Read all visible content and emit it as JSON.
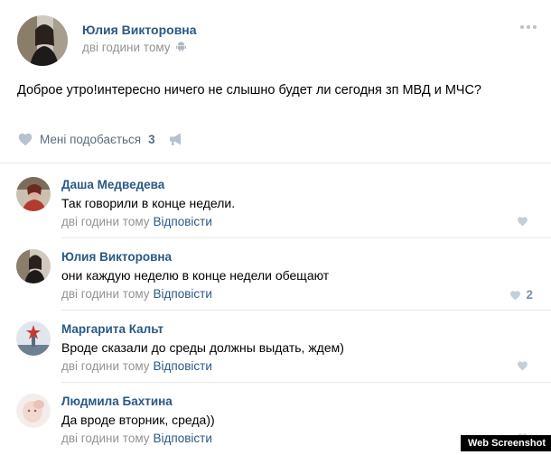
{
  "post": {
    "author": "Юлия Викторовна",
    "time": "дві години тому",
    "text": "Доброе утро!интересно ничего не слышно будет ли сегодня зп МВД и МЧС?",
    "like_label": "Мені подобається",
    "like_count": "3"
  },
  "comments": [
    {
      "author": "Даша Медведева",
      "text": "Так говорили в конце недели.",
      "time": "дві години тому",
      "reply": "Відповісти",
      "likes": ""
    },
    {
      "author": "Юлия Викторовна",
      "text": "они каждую неделю в конце недели обещают",
      "time": "дві години тому",
      "reply": "Відповісти",
      "likes": "2"
    },
    {
      "author": "Маргарита Кальт",
      "text": "Вроде сказали до среды должны выдать, ждем)",
      "time": "дві години тому",
      "reply": "Відповісти",
      "likes": ""
    },
    {
      "author": "Людмила Бахтина",
      "text": "Да вроде вторник, среда))",
      "time": "дві години тому",
      "reply": "Відповісти",
      "likes": ""
    }
  ],
  "watermark": "Web Screenshot",
  "colors": {
    "link": "#2a5885",
    "meta": "#939393",
    "action": "#5b6b7f",
    "like_icon": "#b6c2cf",
    "divider": "#e7e8ec"
  },
  "icons": [
    "android-icon",
    "heart-icon",
    "megaphone-icon",
    "more-icon"
  ]
}
